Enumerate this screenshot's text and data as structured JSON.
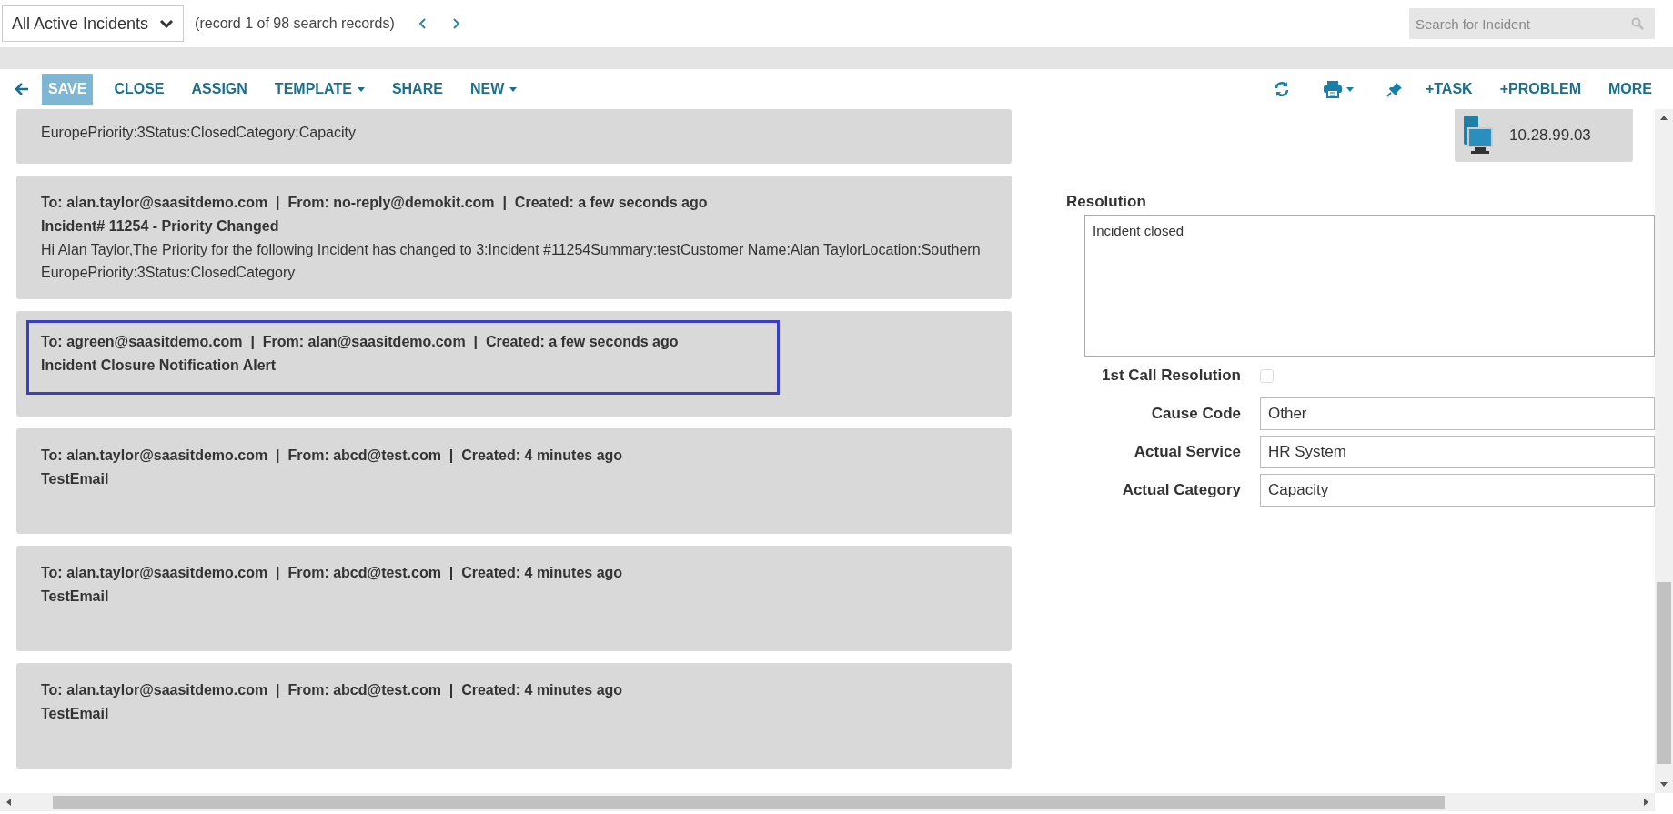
{
  "top_bar": {
    "view_select": "All Active Incidents",
    "record_info": "(record 1 of 98 search records)",
    "search": {
      "placeholder": "Search for Incident"
    }
  },
  "toolbar": {
    "left": [
      {
        "label": "SAVE",
        "kind": "primary"
      },
      {
        "label": "CLOSE",
        "kind": "plain"
      },
      {
        "label": "ASSIGN",
        "kind": "plain"
      },
      {
        "label": "TEMPLATE",
        "kind": "dropdown"
      },
      {
        "label": "SHARE",
        "kind": "plain"
      },
      {
        "label": "NEW",
        "kind": "dropdown"
      }
    ],
    "right": [
      {
        "label": "+TASK"
      },
      {
        "label": "+PROBLEM"
      },
      {
        "label": "MORE"
      }
    ]
  },
  "emails": [
    {
      "body": "EuropePriority:3Status:ClosedCategory:Capacity",
      "selected": false
    },
    {
      "header": "To: alan.taylor@saasitdemo.com  |  From: no-reply@demokit.com  |  Created: a few seconds ago",
      "subject": "Incident# 11254 - Priority Changed",
      "body": "Hi Alan Taylor,The Priority for the following Incident has changed to 3:Incident #11254Summary:testCustomer Name:Alan TaylorLocation:Southern EuropePriority:3Status:ClosedCategory",
      "selected": false
    },
    {
      "header": "To: agreen@saasitdemo.com  |  From: alan@saasitdemo.com  |  Created: a few seconds ago",
      "subject": "Incident Closure Notification Alert",
      "selected": true
    },
    {
      "header": "To: alan.taylor@saasitdemo.com  |  From: abcd@test.com  |  Created: 4 minutes ago",
      "subject": "TestEmail",
      "selected": false
    },
    {
      "header": "To: alan.taylor@saasitdemo.com  |  From: abcd@test.com  |  Created: 4 minutes ago",
      "subject": "TestEmail",
      "selected": false
    },
    {
      "header": "To: alan.taylor@saasitdemo.com  |  From: abcd@test.com  |  Created: 4 minutes ago",
      "subject": "TestEmail",
      "selected": false
    }
  ],
  "device": {
    "address": "10.28.99.03"
  },
  "resolution": {
    "label": "Resolution",
    "value": "Incident closed"
  },
  "fields": [
    {
      "label": "1st Call Resolution",
      "kind": "checkbox",
      "checked": false
    },
    {
      "label": "Cause Code",
      "kind": "text",
      "value": "Other"
    },
    {
      "label": "Actual Service",
      "kind": "text",
      "value": "HR System"
    },
    {
      "label": "Actual Category",
      "kind": "text",
      "value": "Capacity"
    }
  ]
}
